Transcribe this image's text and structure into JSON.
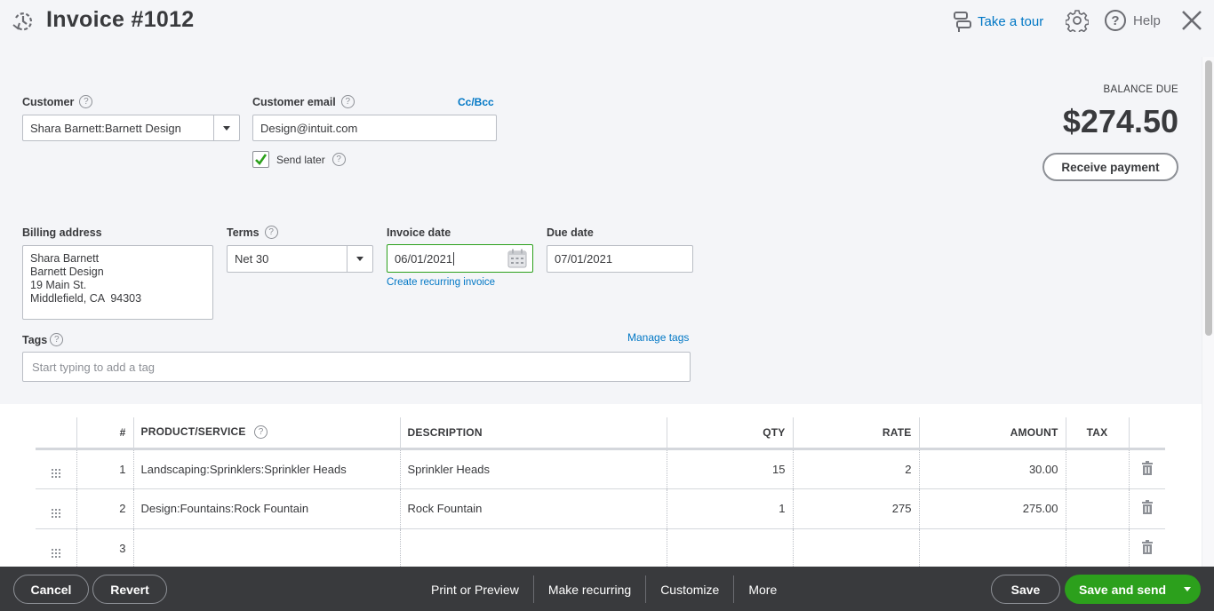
{
  "header": {
    "title": "Invoice #1012",
    "tour_label": "Take a tour",
    "help_label": "Help"
  },
  "customer": {
    "label": "Customer",
    "value": "Shara Barnett:Barnett Design"
  },
  "email": {
    "label": "Customer email",
    "value": "Design@intuit.com",
    "cc_bcc": "Cc/Bcc",
    "send_later_label": "Send later",
    "send_later_checked": true
  },
  "balance": {
    "label": "BALANCE DUE",
    "amount": "$274.50",
    "receive_payment_label": "Receive payment"
  },
  "billing": {
    "label": "Billing address",
    "lines": [
      "Shara Barnett",
      "Barnett Design",
      "19 Main St.",
      "Middlefield, CA  94303"
    ]
  },
  "terms": {
    "label": "Terms",
    "value": "Net 30"
  },
  "invoice_date": {
    "label": "Invoice date",
    "value": "06/01/2021",
    "recurring_link": "Create recurring invoice"
  },
  "due_date": {
    "label": "Due date",
    "value": "07/01/2021"
  },
  "tags": {
    "label": "Tags",
    "manage_link": "Manage tags",
    "placeholder": "Start typing to add a tag"
  },
  "table": {
    "headers": [
      "",
      "#",
      "PRODUCT/SERVICE",
      "DESCRIPTION",
      "QTY",
      "RATE",
      "AMOUNT",
      "TAX",
      ""
    ],
    "rows": [
      {
        "num": "1",
        "product": "Landscaping:Sprinklers:Sprinkler Heads",
        "description": "Sprinkler Heads",
        "qty": "15",
        "rate": "2",
        "amount": "30.00",
        "tax": ""
      },
      {
        "num": "2",
        "product": "Design:Fountains:Rock Fountain",
        "description": "Rock Fountain",
        "qty": "1",
        "rate": "275",
        "amount": "275.00",
        "tax": ""
      },
      {
        "num": "3",
        "product": "",
        "description": "",
        "qty": "",
        "rate": "",
        "amount": "",
        "tax": ""
      }
    ]
  },
  "footer": {
    "cancel": "Cancel",
    "revert": "Revert",
    "print": "Print or Preview",
    "make_recurring": "Make recurring",
    "customize": "Customize",
    "more": "More",
    "save": "Save",
    "save_and_send": "Save and send"
  },
  "colors": {
    "accent_green": "#2ca01c",
    "link_blue": "#0077c5",
    "footer_bg": "#393a3d"
  }
}
